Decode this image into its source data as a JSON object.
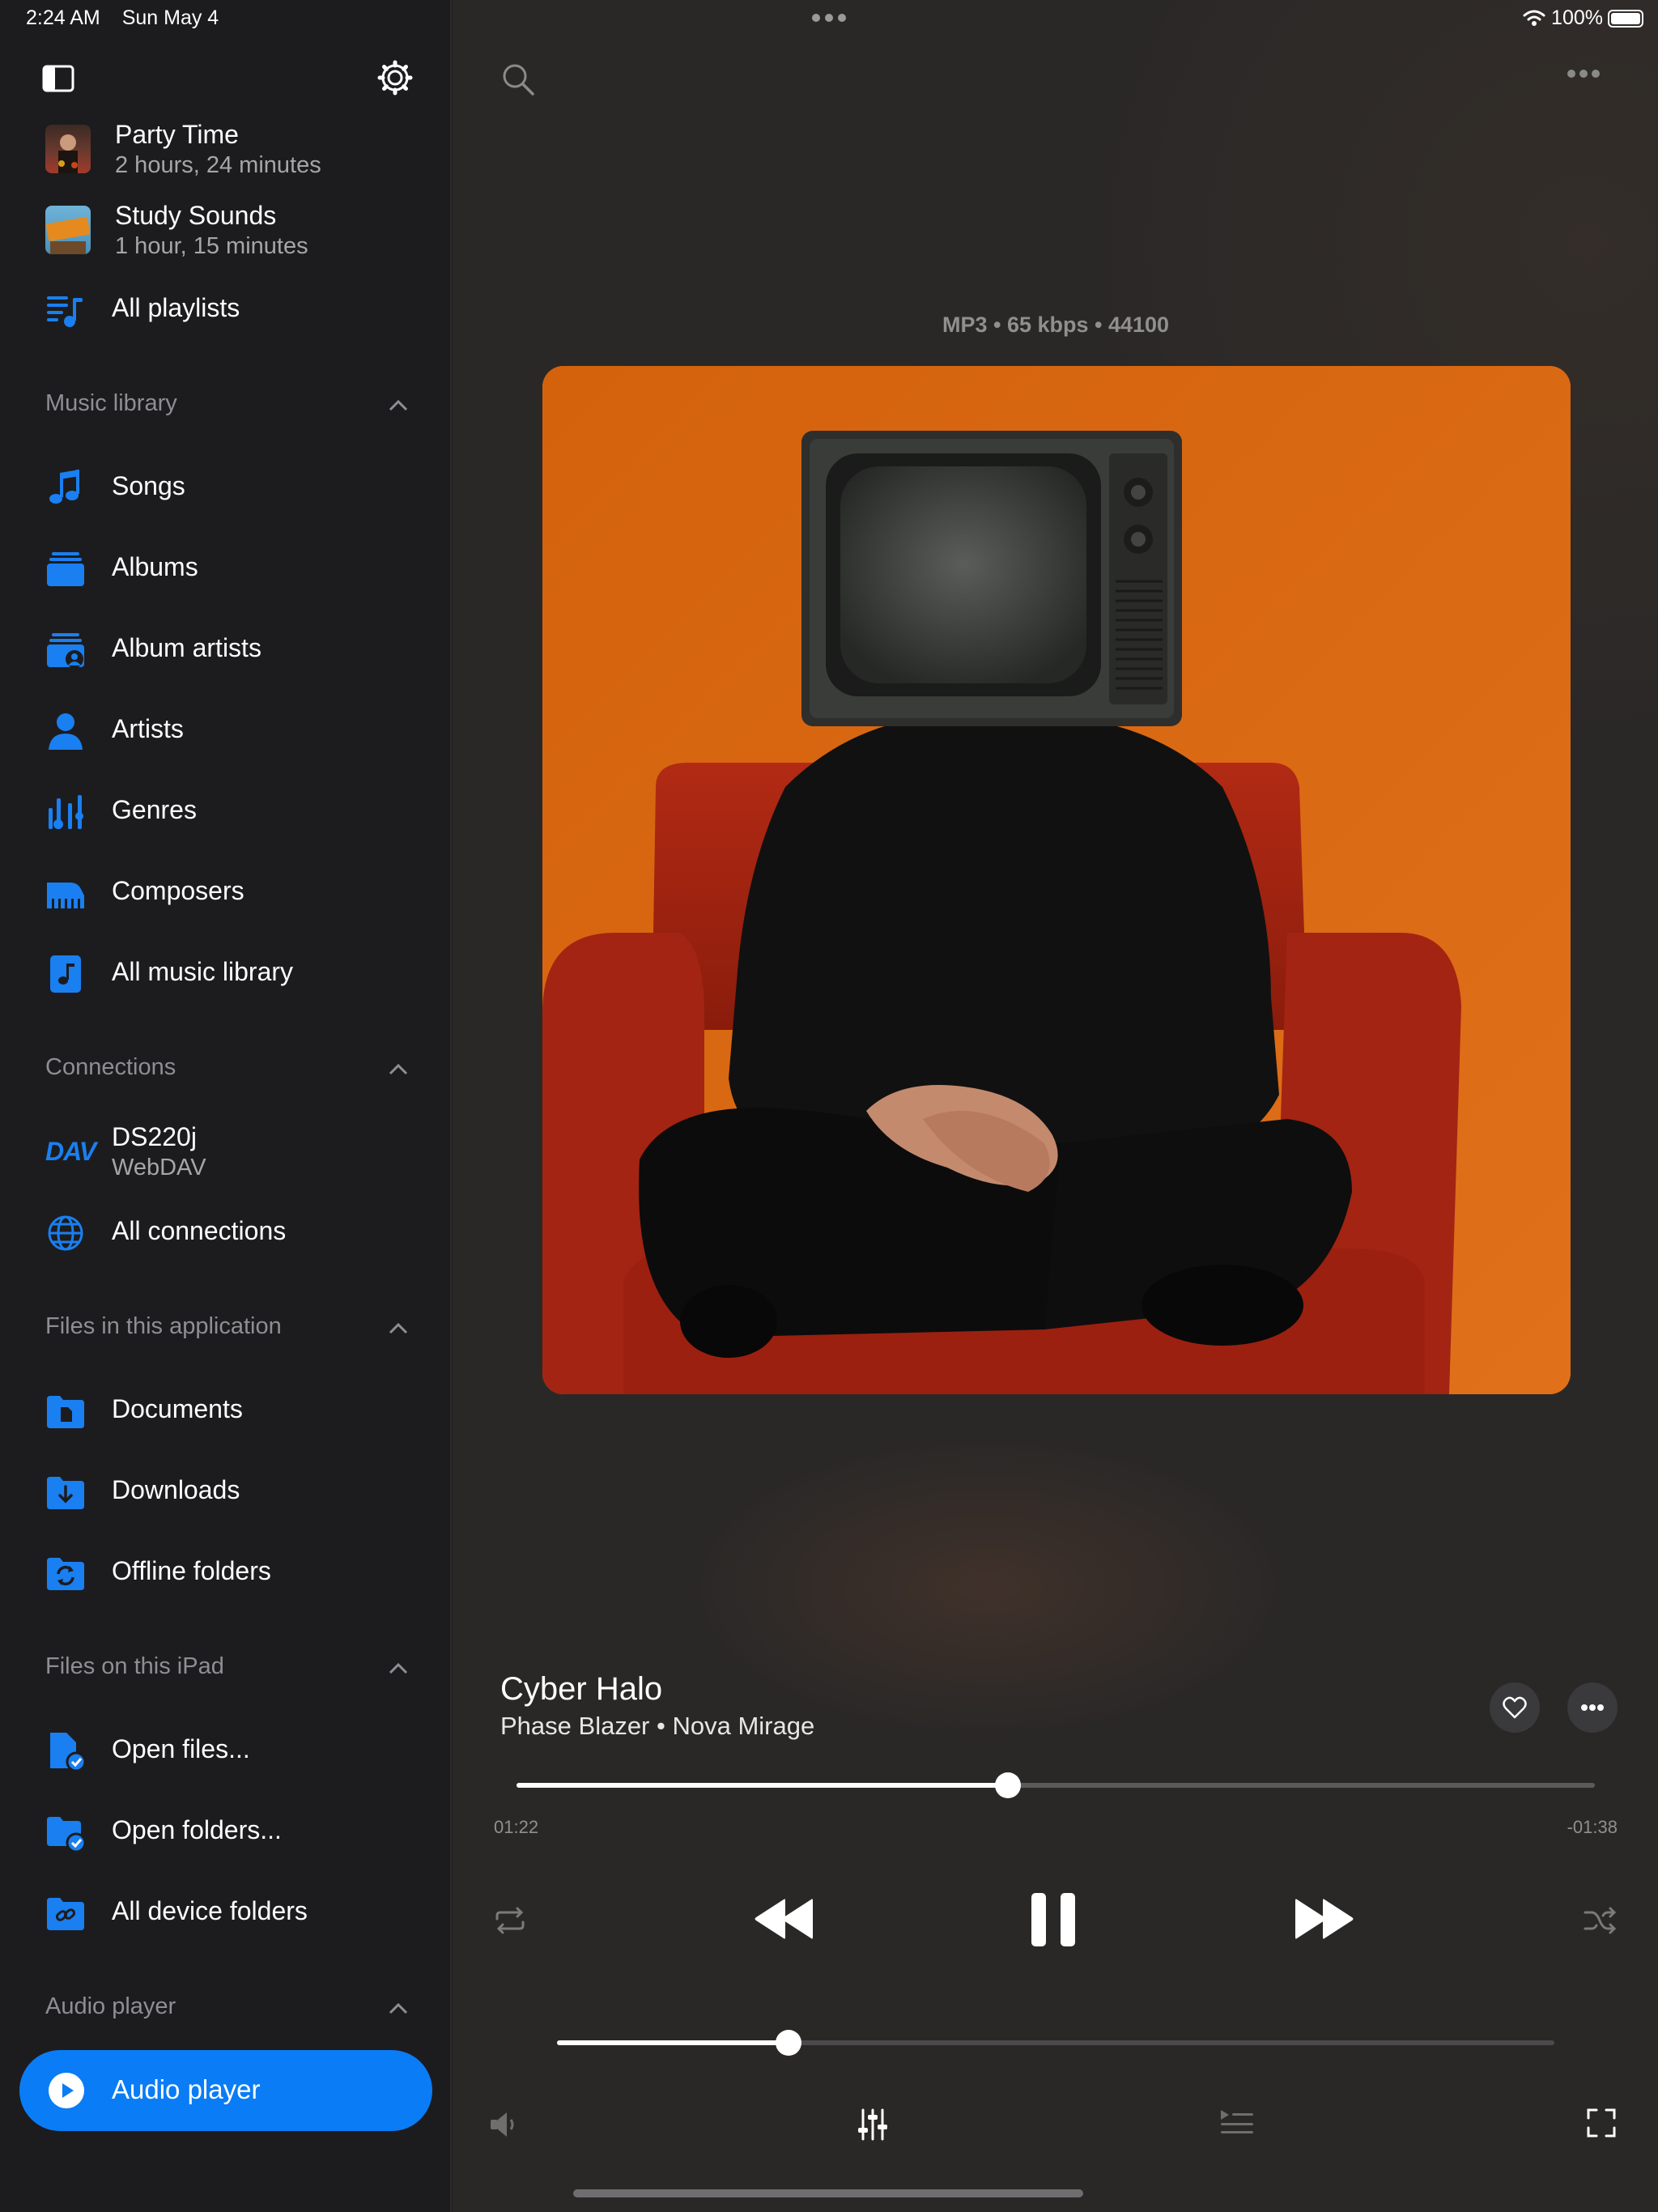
{
  "status_bar": {
    "time": "2:24 AM",
    "date": "Sun May 4",
    "battery": "100%"
  },
  "sidebar": {
    "playlists": [
      {
        "title": "Party Time",
        "duration": "2 hours, 24 minutes"
      },
      {
        "title": "Study Sounds",
        "duration": "1 hour, 15 minutes"
      }
    ],
    "all_playlists": "All playlists",
    "sections": {
      "music_library": {
        "title": "Music library",
        "items": [
          "Songs",
          "Albums",
          "Album artists",
          "Artists",
          "Genres",
          "Composers",
          "All music library"
        ]
      },
      "connections": {
        "title": "Connections",
        "server": {
          "logo": "DAV",
          "name": "DS220j",
          "type": "WebDAV"
        },
        "all": "All connections"
      },
      "files_app": {
        "title": "Files in this application",
        "items": [
          "Documents",
          "Downloads",
          "Offline folders"
        ]
      },
      "files_ipad": {
        "title": "Files on this iPad",
        "items": [
          "Open files...",
          "Open folders...",
          "All device folders"
        ]
      },
      "audio_player": {
        "title": "Audio player",
        "button": "Audio player"
      }
    }
  },
  "player": {
    "format_info": "MP3 • 65 kbps • 44100",
    "track_title": "Cyber Halo",
    "track_subtitle": "Phase Blazer • Nova Mirage",
    "elapsed": "01:22",
    "remaining": "-01:38",
    "progress_fraction": 0.456,
    "volume_fraction": 0.232
  },
  "colors": {
    "accent": "#0a7cf6",
    "sidebar_bg": "#1c1c1e",
    "main_bg": "#2a2827",
    "cover_bg": "#d9650e"
  }
}
